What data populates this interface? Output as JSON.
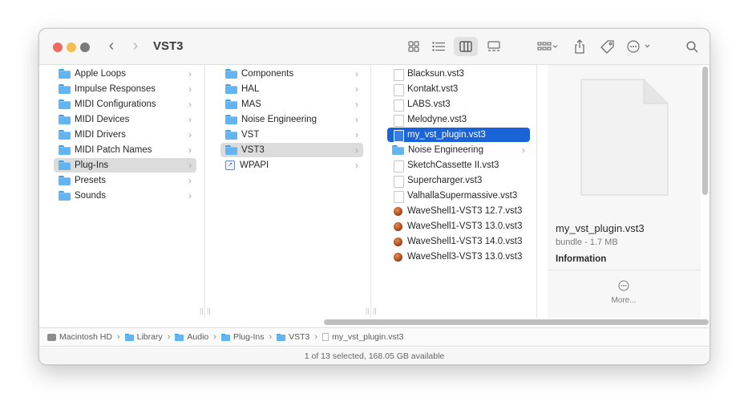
{
  "window": {
    "title": "VST3"
  },
  "toolbar": {
    "icons": [
      "icon-view-icon",
      "list-view-icon",
      "column-view-icon",
      "gallery-view-icon",
      "group-icon",
      "share-icon",
      "tag-icon",
      "more-actions-icon",
      "search-icon"
    ]
  },
  "column1": {
    "items": [
      {
        "label": "Apple Loops"
      },
      {
        "label": "Impulse Responses"
      },
      {
        "label": "MIDI Configurations"
      },
      {
        "label": "MIDI Devices"
      },
      {
        "label": "MIDI Drivers"
      },
      {
        "label": "MIDI Patch Names"
      },
      {
        "label": "Plug-Ins"
      },
      {
        "label": "Presets"
      },
      {
        "label": "Sounds"
      }
    ]
  },
  "column2": {
    "items": [
      {
        "label": "Components"
      },
      {
        "label": "HAL"
      },
      {
        "label": "MAS"
      },
      {
        "label": "Noise Engineering"
      },
      {
        "label": "VST"
      },
      {
        "label": "VST3"
      },
      {
        "label": "WPAPI"
      }
    ]
  },
  "column3": {
    "items": [
      {
        "label": "Blacksun.vst3"
      },
      {
        "label": "Kontakt.vst3"
      },
      {
        "label": "LABS.vst3"
      },
      {
        "label": "Melodyne.vst3"
      },
      {
        "label": "my_vst_plugin.vst3"
      },
      {
        "label": "Noise Engineering"
      },
      {
        "label": "SketchCassette II.vst3"
      },
      {
        "label": "Supercharger.vst3"
      },
      {
        "label": "ValhallaSupermassive.vst3"
      },
      {
        "label": "WaveShell1-VST3 12.7.vst3"
      },
      {
        "label": "WaveShell1-VST3 13.0.vst3"
      },
      {
        "label": "WaveShell1-VST3 14.0.vst3"
      },
      {
        "label": "WaveShell3-VST3 13.0.vst3"
      }
    ]
  },
  "preview": {
    "name": "my_vst_plugin.vst3",
    "kind": "bundle - 1.7 MB",
    "section": "Information",
    "more_label": "More..."
  },
  "pathbar": {
    "crumbs": [
      "Macintosh HD",
      "Library",
      "Audio",
      "Plug-Ins",
      "VST3",
      "my_vst_plugin.vst3"
    ]
  },
  "status": {
    "text": "1 of 13 selected, 168.05 GB available"
  },
  "colors": {
    "selection": "#1a64d8",
    "folder": "#62b5f0"
  }
}
